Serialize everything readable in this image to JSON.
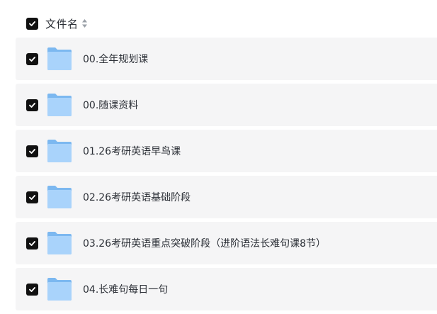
{
  "header": {
    "column_label": "文件名",
    "select_all_checked": true,
    "sort_icon": "sort-icon"
  },
  "files": [
    {
      "name": "00.全年规划课",
      "checked": true,
      "icon": "folder-icon"
    },
    {
      "name": "00.随课资料",
      "checked": true,
      "icon": "folder-icon"
    },
    {
      "name": "01.26考研英语早鸟课",
      "checked": true,
      "icon": "folder-icon"
    },
    {
      "name": "02.26考研英语基础阶段",
      "checked": true,
      "icon": "folder-icon"
    },
    {
      "name": "03.26考研英语重点突破阶段（进阶语法长难句课8节）",
      "checked": true,
      "icon": "folder-icon"
    },
    {
      "name": "04.长难句每日一句",
      "checked": true,
      "icon": "folder-icon"
    }
  ],
  "colors": {
    "row_background": "#f5f5f6",
    "checkbox": "#111111",
    "folder_back": "#7cb8f0",
    "folder_front": "#a9d3fb"
  }
}
